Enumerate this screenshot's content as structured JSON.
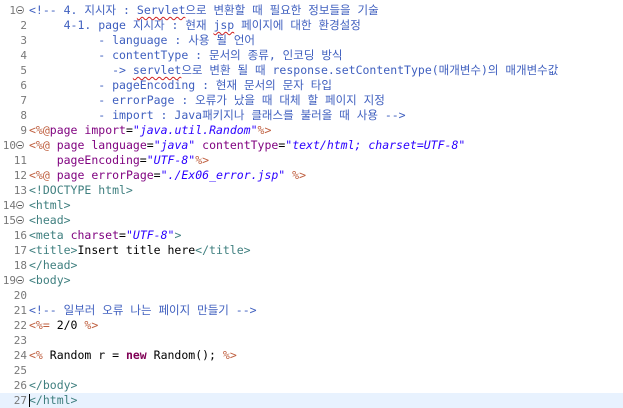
{
  "editor": {
    "current_line": 27,
    "lines": [
      {
        "num": "1",
        "fold": true,
        "tokens": [
          {
            "t": "comment",
            "v": "<!-- 4. 지시자 : "
          },
          {
            "t": "comment-squiggle",
            "v": "Servlet"
          },
          {
            "t": "comment",
            "v": "으로 변환할 때 필요한 정보들을 기술"
          }
        ]
      },
      {
        "num": "2",
        "tokens": [
          {
            "t": "comment",
            "v": "     4-1. page 지시자 : 현재 "
          },
          {
            "t": "comment-squiggle",
            "v": "jsp"
          },
          {
            "t": "comment",
            "v": " 페이지에 대한 환경설정"
          }
        ]
      },
      {
        "num": "3",
        "tokens": [
          {
            "t": "comment",
            "v": "          - language : 사용 될 언어"
          }
        ]
      },
      {
        "num": "4",
        "tokens": [
          {
            "t": "comment",
            "v": "          - contentType : 문서의 종류, 인코딩 방식"
          }
        ]
      },
      {
        "num": "5",
        "tokens": [
          {
            "t": "comment",
            "v": "            -> "
          },
          {
            "t": "comment-squiggle",
            "v": "servlet"
          },
          {
            "t": "comment",
            "v": "으로 변환 될 때 response.setContentType(매개변수)의 매개변수값"
          }
        ]
      },
      {
        "num": "6",
        "tokens": [
          {
            "t": "comment",
            "v": "          - pageEncoding : 현재 문서의 문자 타입"
          }
        ]
      },
      {
        "num": "7",
        "tokens": [
          {
            "t": "comment",
            "v": "          - errorPage : 오류가 났을 때 대체 할 페이지 지정"
          }
        ]
      },
      {
        "num": "8",
        "tokens": [
          {
            "t": "comment",
            "v": "          - import : Java패키지나 클래스를 불러올 때 사용 -->"
          }
        ]
      },
      {
        "num": "9",
        "tokens": [
          {
            "t": "directive",
            "v": "<%@"
          },
          {
            "t": "attr",
            "v": "page"
          },
          {
            "t": "plain",
            "v": " "
          },
          {
            "t": "attr",
            "v": "import"
          },
          {
            "t": "plain",
            "v": "="
          },
          {
            "t": "value",
            "v": "\"java.util.Random\""
          },
          {
            "t": "directive",
            "v": "%>"
          }
        ]
      },
      {
        "num": "10",
        "fold": true,
        "tokens": [
          {
            "t": "directive",
            "v": "<%@"
          },
          {
            "t": "plain",
            "v": " "
          },
          {
            "t": "attr",
            "v": "page"
          },
          {
            "t": "plain",
            "v": " "
          },
          {
            "t": "attr",
            "v": "language"
          },
          {
            "t": "plain",
            "v": "="
          },
          {
            "t": "value",
            "v": "\"java\""
          },
          {
            "t": "plain",
            "v": " "
          },
          {
            "t": "attr",
            "v": "contentType"
          },
          {
            "t": "plain",
            "v": "="
          },
          {
            "t": "value",
            "v": "\"text/html; charset=UTF-8\""
          }
        ]
      },
      {
        "num": "11",
        "tokens": [
          {
            "t": "plain",
            "v": "    "
          },
          {
            "t": "attr",
            "v": "pageEncoding"
          },
          {
            "t": "plain",
            "v": "="
          },
          {
            "t": "value",
            "v": "\"UTF-8\""
          },
          {
            "t": "directive",
            "v": "%>"
          }
        ]
      },
      {
        "num": "12",
        "tokens": [
          {
            "t": "directive",
            "v": "<%@"
          },
          {
            "t": "plain",
            "v": " "
          },
          {
            "t": "attr",
            "v": "page"
          },
          {
            "t": "plain",
            "v": " "
          },
          {
            "t": "attr",
            "v": "errorPage"
          },
          {
            "t": "plain",
            "v": "="
          },
          {
            "t": "value",
            "v": "\"./Ex06_error.jsp\""
          },
          {
            "t": "plain",
            "v": " "
          },
          {
            "t": "directive",
            "v": "%>"
          }
        ]
      },
      {
        "num": "13",
        "tokens": [
          {
            "t": "tag",
            "v": "<!DOCTYPE html>"
          }
        ]
      },
      {
        "num": "14",
        "fold": true,
        "tokens": [
          {
            "t": "tag",
            "v": "<html>"
          }
        ]
      },
      {
        "num": "15",
        "fold": true,
        "tokens": [
          {
            "t": "tag",
            "v": "<head>"
          }
        ]
      },
      {
        "num": "16",
        "tokens": [
          {
            "t": "tag",
            "v": "<meta"
          },
          {
            "t": "plain",
            "v": " "
          },
          {
            "t": "attr",
            "v": "charset"
          },
          {
            "t": "plain",
            "v": "="
          },
          {
            "t": "value",
            "v": "\"UTF-8\""
          },
          {
            "t": "tag",
            "v": ">"
          }
        ]
      },
      {
        "num": "17",
        "tokens": [
          {
            "t": "tag",
            "v": "<title>"
          },
          {
            "t": "plain",
            "v": "Insert title here"
          },
          {
            "t": "tag",
            "v": "</title>"
          }
        ]
      },
      {
        "num": "18",
        "tokens": [
          {
            "t": "tag",
            "v": "</head>"
          }
        ]
      },
      {
        "num": "19",
        "fold": true,
        "tokens": [
          {
            "t": "tag",
            "v": "<body>"
          }
        ]
      },
      {
        "num": "20",
        "tokens": []
      },
      {
        "num": "21",
        "tokens": [
          {
            "t": "comment",
            "v": "<!-- 일부러 오류 나는 페이지 만들기 -->"
          }
        ]
      },
      {
        "num": "22",
        "tokens": [
          {
            "t": "directive",
            "v": "<%="
          },
          {
            "t": "plain",
            "v": " 2/0 "
          },
          {
            "t": "directive",
            "v": "%>"
          }
        ]
      },
      {
        "num": "23",
        "tokens": []
      },
      {
        "num": "24",
        "tokens": [
          {
            "t": "directive",
            "v": "<%"
          },
          {
            "t": "plain",
            "v": " Random r = "
          },
          {
            "t": "keyword",
            "v": "new"
          },
          {
            "t": "plain",
            "v": " Random(); "
          },
          {
            "t": "directive",
            "v": "%>"
          }
        ]
      },
      {
        "num": "25",
        "tokens": []
      },
      {
        "num": "26",
        "tokens": [
          {
            "t": "tag",
            "v": "</body>"
          }
        ]
      },
      {
        "num": "27",
        "tokens": [
          {
            "t": "tag",
            "v": "</html>"
          }
        ]
      }
    ]
  }
}
